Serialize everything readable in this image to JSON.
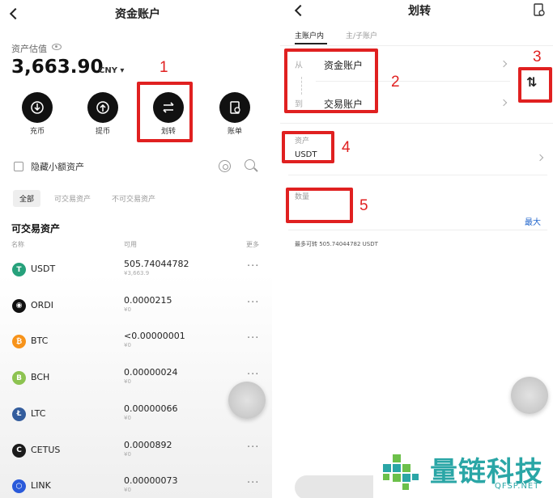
{
  "left": {
    "title": "资金账户",
    "estimate_label": "资产估值",
    "balance": "3,663.90",
    "currency": "CNY ▾",
    "actions": [
      {
        "label": "充币",
        "icon": "download-icon"
      },
      {
        "label": "提币",
        "icon": "upload-icon"
      },
      {
        "label": "划转",
        "icon": "transfer-icon"
      },
      {
        "label": "账单",
        "icon": "bill-icon"
      }
    ],
    "hide_small": "隐藏小额资产",
    "filters": [
      "全部",
      "可交易资产",
      "不可交易资产"
    ],
    "section_title": "可交易资产",
    "columns": [
      "名称",
      "可用",
      "更多"
    ],
    "assets": [
      {
        "name": "USDT",
        "amount": "505.74044782",
        "sub": "¥3,663.9",
        "color": "#26a17b",
        "glyph": "T"
      },
      {
        "name": "ORDI",
        "amount": "0.0000215",
        "sub": "¥0",
        "color": "#111111",
        "glyph": "◉"
      },
      {
        "name": "BTC",
        "amount": "<0.00000001",
        "sub": "¥0",
        "color": "#f7931a",
        "glyph": "₿"
      },
      {
        "name": "BCH",
        "amount": "0.00000024",
        "sub": "¥0",
        "color": "#8dc351",
        "glyph": "B"
      },
      {
        "name": "LTC",
        "amount": "0.00000066",
        "sub": "¥0",
        "color": "#345d9d",
        "glyph": "Ł"
      },
      {
        "name": "CETUS",
        "amount": "0.0000892",
        "sub": "¥0",
        "color": "#1b1b1b",
        "glyph": "C"
      },
      {
        "name": "LINK",
        "amount": "0.00000073",
        "sub": "¥0",
        "color": "#2a5ada",
        "glyph": "⬡"
      }
    ],
    "more": "···"
  },
  "right": {
    "title": "划转",
    "tabs": [
      "主账户内",
      "主/子账户"
    ],
    "from_label": "从",
    "from_account": "资金账户",
    "to_label": "到",
    "to_account": "交易账户",
    "asset_label": "资产",
    "asset_value": "USDT",
    "amount_label": "数量",
    "max_label": "最大",
    "max_transfer": "最多可转 505.74044782 USDT"
  },
  "annotations": [
    "1",
    "2",
    "3",
    "4",
    "5"
  ],
  "watermark": {
    "text": "量链科技",
    "sub": "QFSP.NET"
  },
  "colors": {
    "annotation": "#e02020",
    "accent": "#2266cc",
    "watermark": "#2aa6a6"
  }
}
